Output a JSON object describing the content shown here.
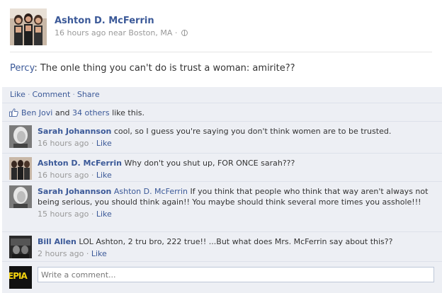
{
  "post": {
    "author": "Ashton D. McFerrin",
    "meta_time": "16 hours ago near Boston, MA",
    "meta_sep": "·",
    "status_who": "Percy",
    "status_text": ": The onle thing you can't do is trust a woman: amirite??"
  },
  "actions": {
    "like": "Like",
    "comment": "Comment",
    "share": "Share",
    "sep": "·"
  },
  "likes": {
    "person": "Ben Jovi",
    "and": "and",
    "others": "34 others",
    "suffix": "like this."
  },
  "comments": [
    {
      "name": "Sarah Johannson",
      "mention": "",
      "text": "cool, so I guess you're saying you don't think women are to be trusted.",
      "time": "16 hours ago",
      "like": "Like"
    },
    {
      "name": "Ashton D. McFerrin",
      "mention": "",
      "text": "Why don't you shut up, FOR ONCE sarah???",
      "time": "16 hours ago",
      "like": "Like"
    },
    {
      "name": "Sarah Johannson",
      "mention": "Ashton D. McFerrin",
      "text": "If you think that people who think that way aren't always not being serious, you should think again!! You maybe should think several more times you asshole!!!",
      "time": "15 hours ago",
      "like": "Like"
    },
    {
      "name": "Bill Allen",
      "mention": "",
      "text": "LOL Ashton, 2 tru bro, 222 true!! ...But what does Mrs. McFerrin say about this??",
      "time": "2 hours ago",
      "like": "Like"
    }
  ],
  "comment_input": {
    "placeholder": "Write a comment...",
    "avatar_text": "EPIA"
  },
  "colors": {
    "link": "#3b5998",
    "feedback_bg": "#edeff4",
    "meta_gray": "#999999"
  }
}
